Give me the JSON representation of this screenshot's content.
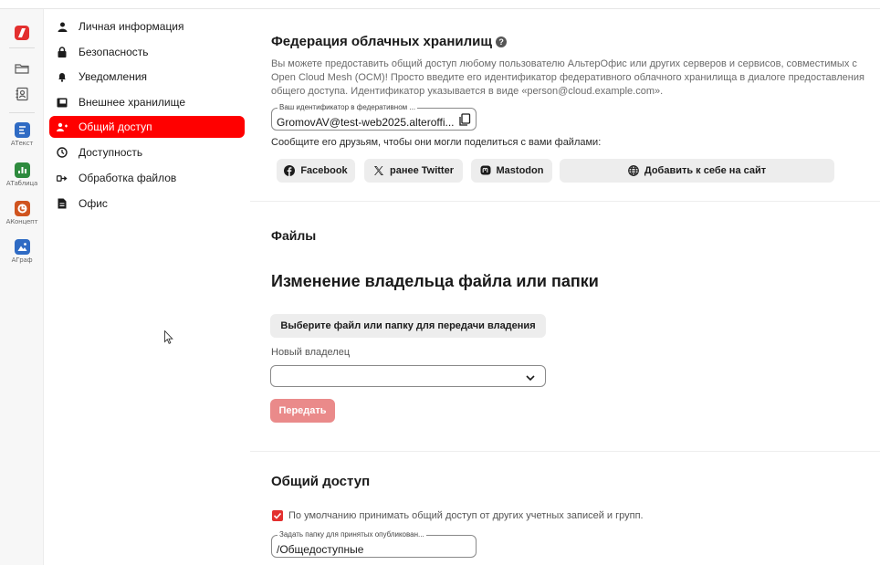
{
  "rail": {
    "apps": [
      {
        "label": "АТекст",
        "color": "#2f6bc4"
      },
      {
        "label": "АТаблица",
        "color": "#2e8b3e"
      },
      {
        "label": "АКонцепт",
        "color": "#d0541f"
      },
      {
        "label": "АГраф",
        "color": "#2f6bc4"
      }
    ]
  },
  "nav": {
    "items": [
      {
        "label": "Личная информация"
      },
      {
        "label": "Безопасность"
      },
      {
        "label": "Уведомления"
      },
      {
        "label": "Внешнее хранилище"
      },
      {
        "label": "Общий доступ"
      },
      {
        "label": "Доступность"
      },
      {
        "label": "Обработка файлов"
      },
      {
        "label": "Офис"
      }
    ],
    "active_index": 4
  },
  "federation": {
    "title": "Федерация облачных хранилищ",
    "help_glyph": "?",
    "description": "Вы можете предоставить общий доступ любому пользователю АльтерОфис или других серверов и сервисов, совместимых с Open Cloud Mesh (OCM)! Просто введите его идентификатор федеративного облачного хранилища в диалоге предоставления общего доступа. Идентификатор указывается в виде «person@cloud.example.com».",
    "id_field_label": "Ваш идентификатор в федеративном ...",
    "id_field_value": "GromovAV@test-web2025.alteroffi...",
    "share_with_friends": "Сообщите его друзьям, чтобы они могли поделиться с вами файлами:",
    "buttons": {
      "facebook": "Facebook",
      "twitter": "ранее Twitter",
      "mastodon": "Mastodon",
      "add_to_site": "Добавить к себе на сайт"
    }
  },
  "files": {
    "title": "Файлы",
    "owner_title": "Изменение владельца файла или папки",
    "pick_button": "Выберите файл или папку для передачи владения",
    "new_owner_label": "Новый владелец",
    "new_owner_value": "",
    "transfer_button": "Передать",
    "transfer_color": "#ea8a8a"
  },
  "sharing": {
    "title": "Общий доступ",
    "accept_default_label": "По умолчанию принимать общий доступ от других учетных записей и групп.",
    "accept_default_checked": true,
    "folder_field_label": "Задать папку для принятых опубликован...",
    "folder_field_value": "/Общедоступные"
  },
  "accent": "#ff0000"
}
